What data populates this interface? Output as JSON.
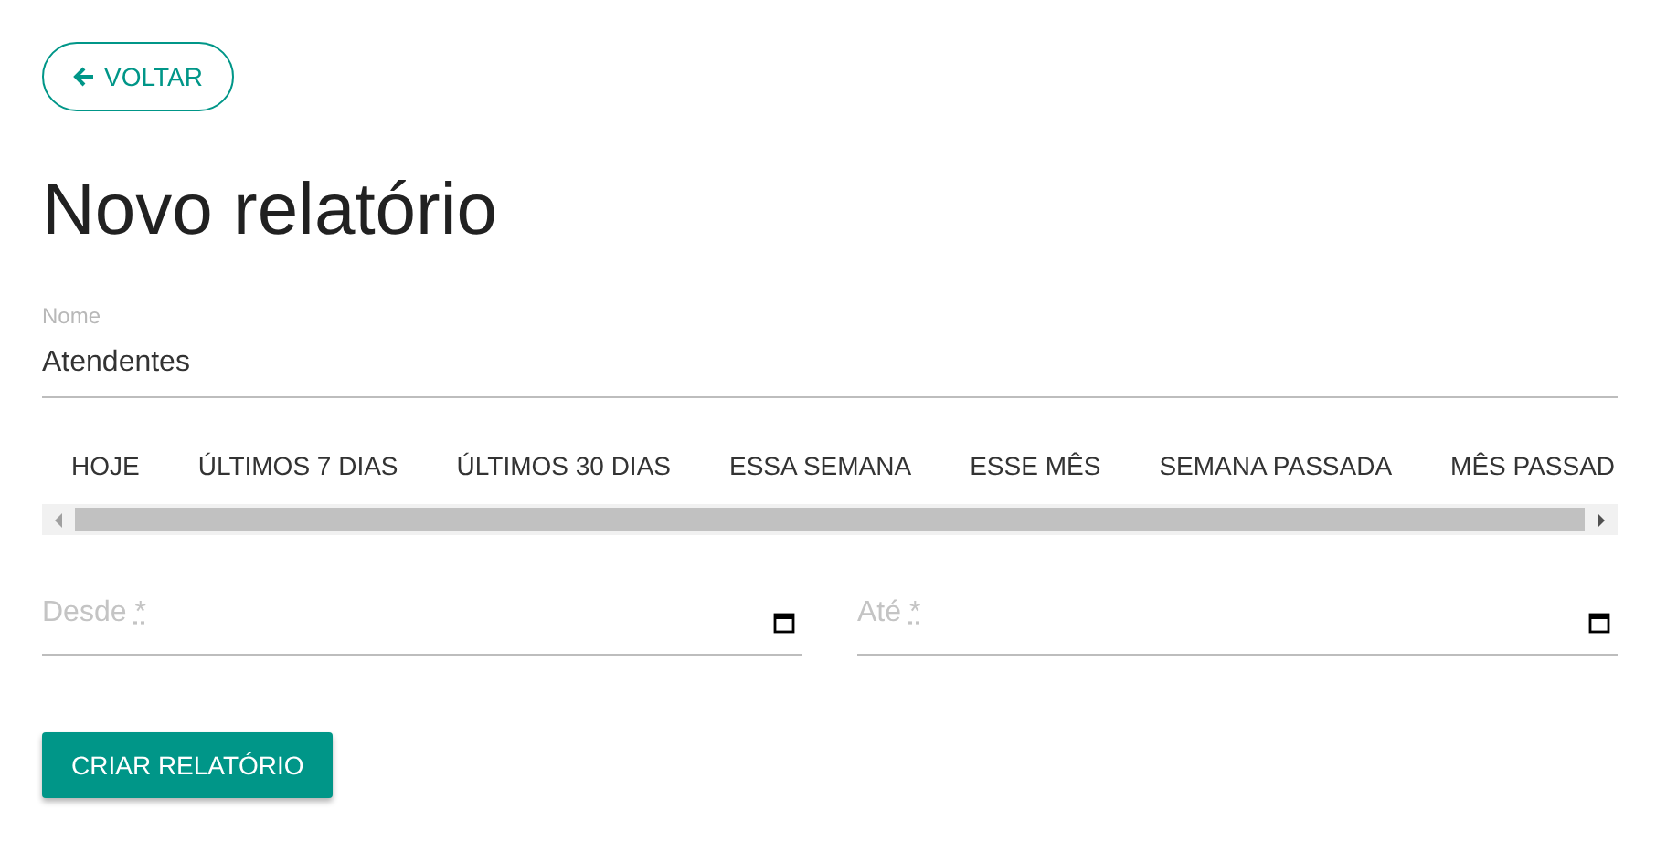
{
  "back_button": {
    "label": "VOLTAR"
  },
  "title": "Novo relatório",
  "name_field": {
    "label": "Nome",
    "value": "Atendentes"
  },
  "period_tabs": [
    "HOJE",
    "ÚLTIMOS 7 DIAS",
    "ÚLTIMOS 30 DIAS",
    "ESSA SEMANA",
    "ESSE MÊS",
    "SEMANA PASSADA",
    "MÊS PASSAD"
  ],
  "date_fields": [
    {
      "label": "Desde",
      "required_mark": "*"
    },
    {
      "label": "Até",
      "required_mark": "*"
    }
  ],
  "submit_button": {
    "label": "CRIAR RELATÓRIO"
  }
}
